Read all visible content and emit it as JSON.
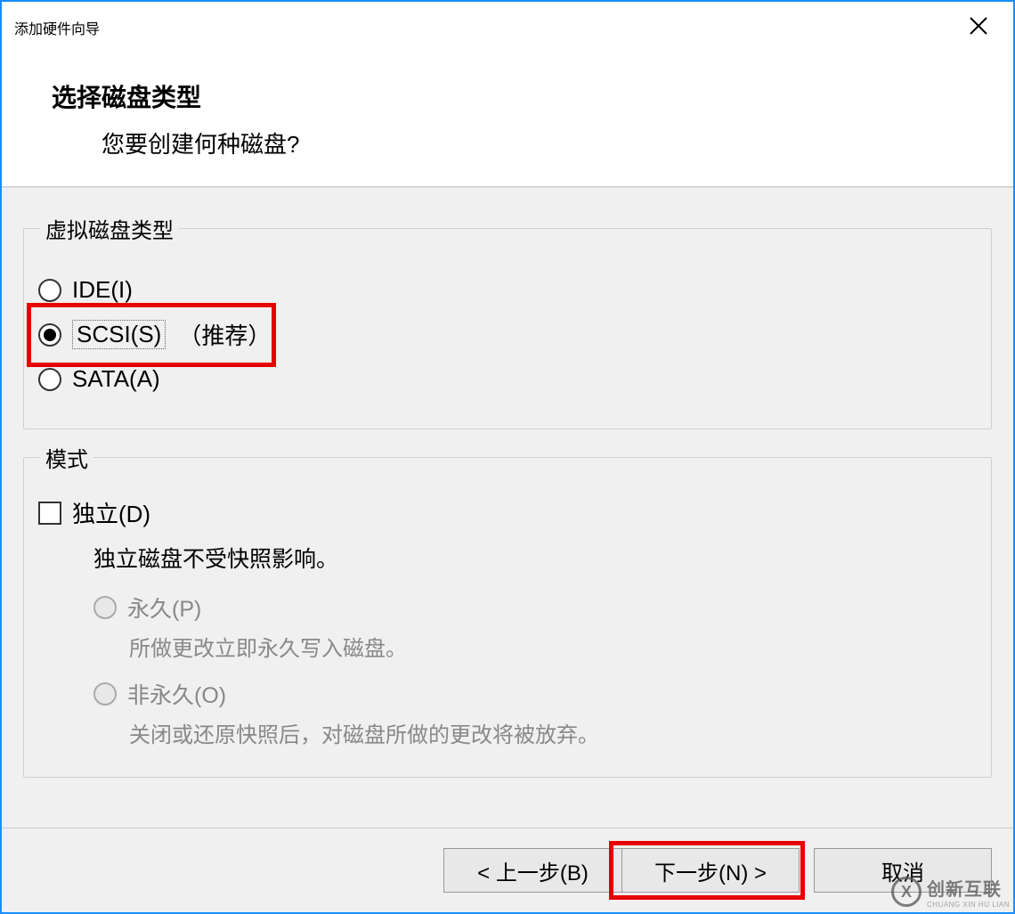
{
  "window": {
    "title": "添加硬件向导"
  },
  "header": {
    "title": "选择磁盘类型",
    "subtitle": "您要创建何种磁盘?"
  },
  "disk_type": {
    "legend": "虚拟磁盘类型",
    "options": {
      "ide": "IDE(I)",
      "scsi": "SCSI(S)",
      "scsi_extra": "（推荐）",
      "sata": "SATA(A)"
    },
    "selected": "scsi"
  },
  "mode": {
    "legend": "模式",
    "independent_label": "独立(D)",
    "independent_desc": "独立磁盘不受快照影响。",
    "persistent_label": "永久(P)",
    "persistent_desc": "所做更改立即永久写入磁盘。",
    "nonpersistent_label": "非永久(O)",
    "nonpersistent_desc": "关闭或还原快照后，对磁盘所做的更改将被放弃。"
  },
  "footer": {
    "back": "< 上一步(B)",
    "next": "下一步(N) >",
    "cancel": "取消"
  },
  "watermark": {
    "brand": "创新互联",
    "sub": "CHUANG XIN HU LIAN"
  }
}
